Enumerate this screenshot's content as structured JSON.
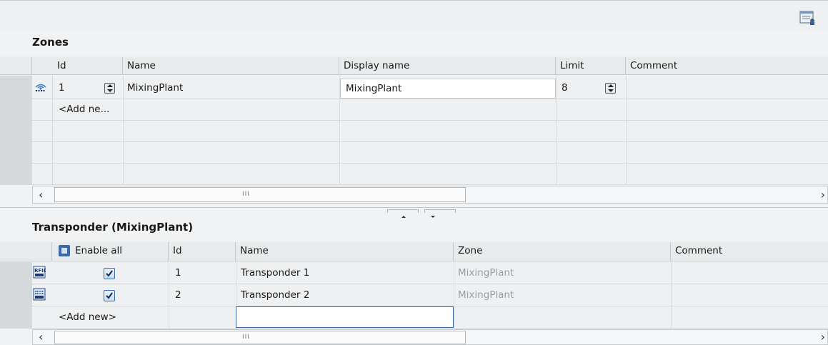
{
  "zones": {
    "title": "Zones",
    "columns": [
      "Id",
      "Name",
      "Display name",
      "Limit",
      "Comment"
    ],
    "rows": [
      {
        "id": "1",
        "name": "MixingPlant",
        "display_name": "MixingPlant",
        "limit": "8",
        "comment": ""
      }
    ],
    "add_new": "<Add ne..."
  },
  "transponder": {
    "title": "Transponder (MixingPlant)",
    "enable_all_label": "Enable all",
    "columns": [
      "Id",
      "Name",
      "Zone",
      "Comment"
    ],
    "rows": [
      {
        "enabled": true,
        "id": "1",
        "name": "Transponder 1",
        "zone": "MixingPlant",
        "comment": ""
      },
      {
        "enabled": true,
        "id": "2",
        "name": "Transponder 2",
        "zone": "MixingPlant",
        "comment": ""
      }
    ],
    "add_new": "<Add new>"
  },
  "scroll": {
    "left_arrow": "‹",
    "right_arrow": "›",
    "grip": "III"
  },
  "colors": {
    "accent": "#3a6aa9",
    "header_bg": "#e8ebec",
    "grid_bg": "#eef0f1"
  }
}
